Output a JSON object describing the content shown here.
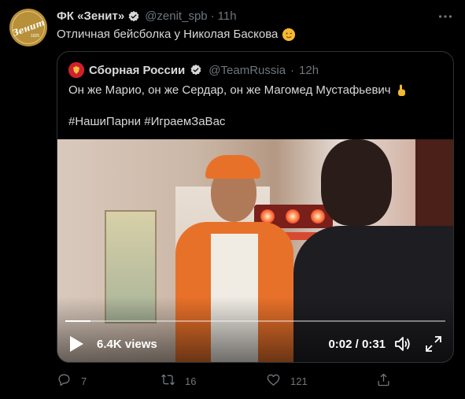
{
  "tweet": {
    "author_name": "ФК «Зенит»",
    "handle": "@zenit_spb",
    "separator": "·",
    "time": "11h",
    "text": "Отличная бейсболка у Николая Баскова",
    "avatar_text": "Зенит",
    "avatar_year": "1925"
  },
  "quoted": {
    "author_name": "Сборная России",
    "handle": "@TeamRussia",
    "separator": "·",
    "time": "12h",
    "text": "Он же Марио, он же Сердар, он же Магомед Мустафьевич",
    "hashtags": "#НашиПарни #ИграемЗаВас"
  },
  "video": {
    "views": "6.4K views",
    "time": "0:02 / 0:31",
    "progress": 0.066
  },
  "actions": {
    "replies": "7",
    "retweets": "16",
    "likes": "121"
  },
  "colors": {
    "background": "#000000",
    "text": "#d9d9d9",
    "muted": "#6e767d",
    "verified": "#d9d9d9",
    "zenit_gold": "#b8903a",
    "russia_red": "#d0202a"
  },
  "icons": [
    "verified-icon",
    "more-icon",
    "wink-emoji-icon",
    "pointing-up-emoji-icon",
    "play-icon",
    "volume-icon",
    "fullscreen-icon",
    "reply-icon",
    "retweet-icon",
    "like-icon",
    "share-icon"
  ]
}
